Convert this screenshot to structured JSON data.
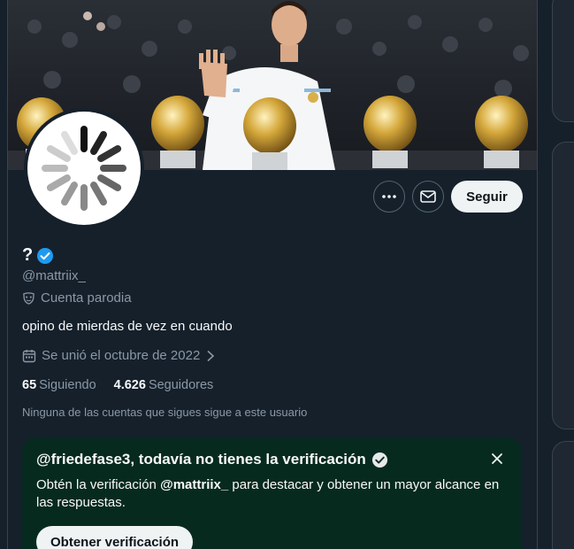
{
  "profile": {
    "display_name": "?",
    "handle": "@mattriix_",
    "parody_label": "Cuenta parodia",
    "bio": "opino de mierdas de vez en cuando",
    "joined": "Se unió el octubre de 2022",
    "following_count": "65",
    "following_label": "Siguiendo",
    "followers_count": "4.626",
    "followers_label": "Seguidores",
    "mutuals_text": "Ninguna de las cuentas que sigues sigue a este usuario"
  },
  "actions": {
    "follow_label": "Seguir",
    "more_icon": "more-icon",
    "message_icon": "envelope-icon"
  },
  "verification": {
    "title": "@friedefase3, todavía no tienes la verificación",
    "desc_pre": "Obtén la verificación ",
    "desc_handle": "@mattriix_",
    "desc_post": " para destacar y obtener un mayor alcance en las respuestas.",
    "button_label": "Obtener verificación"
  },
  "colors": {
    "background": "#15202b",
    "verified_blue": "#1d9bf0",
    "card_green": "#072a1f",
    "muted_text": "#8b98a5"
  }
}
